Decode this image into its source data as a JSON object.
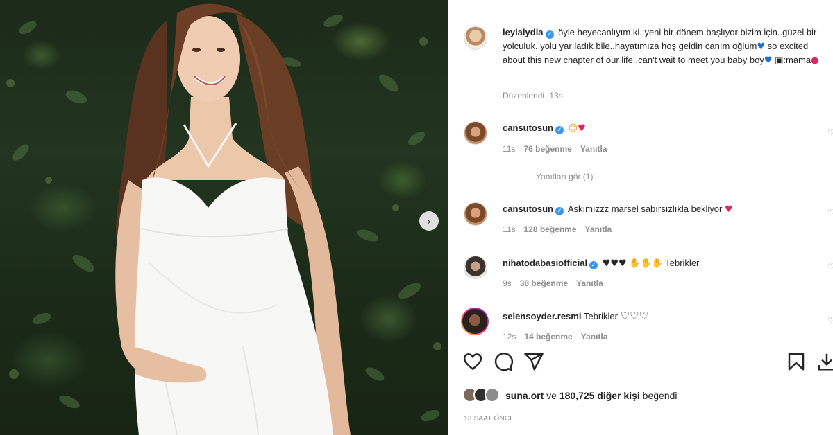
{
  "post": {
    "author": "leylalydia",
    "caption": "öyle heyecanlıyım ki..yeni bir dönem başlıyor bizim için..güzel bir yolculuk..yolu yarıladık bile..hayatımıza hoş geldin canım oğlum",
    "caption_en": "so excited about this new chapter of our life..can't wait to meet you baby boy",
    "caption_credit": ":mama",
    "edited_label": "Düzenlendi",
    "edited_time": "13s"
  },
  "comments": [
    {
      "user": "cansutosun",
      "text": "",
      "time": "11s",
      "likes": "76 beğenme",
      "reply": "Yanıtla"
    },
    {
      "user": "cansutosun",
      "text": "Askımızzz marsel sabırsızlıkla bekliyor",
      "time": "11s",
      "likes": "128 beğenme",
      "reply": "Yanıtla"
    },
    {
      "user": "nihatodabasiofficial",
      "text": "Tebrikler",
      "time": "9s",
      "likes": "38 beğenme",
      "reply": "Yanıtla"
    },
    {
      "user": "selensoyder.resmi",
      "text": "Tebrikler",
      "time": "12s",
      "likes": "14 beğenme",
      "reply": "Yanıtla"
    }
  ],
  "view_replies": "Yanıtları gör (1)",
  "likes": {
    "user": "suna.ort",
    "connector": "ve",
    "others": "180,725 diğer kişi",
    "suffix": "beğendi"
  },
  "timestamp": "13 SAAT ÖNCE",
  "colors": {
    "verified": "#3897f0",
    "muted": "#8e8e8e",
    "text": "#262626"
  },
  "icons": [
    "verified-badge-icon",
    "heart-icon",
    "comment-icon",
    "share-icon",
    "bookmark-icon",
    "download-icon",
    "chevron-right-icon"
  ]
}
